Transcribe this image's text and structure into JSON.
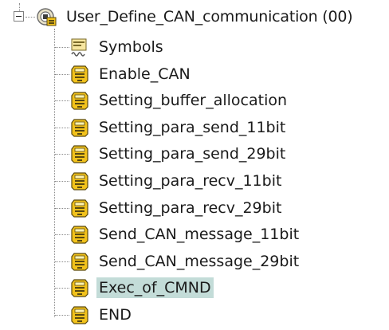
{
  "tree": {
    "root": {
      "label": "User_Define_CAN_communication (00)",
      "icon": "program-module-icon",
      "expanded": true
    },
    "children": [
      {
        "label": "Symbols",
        "icon": "symbols-icon",
        "selected": false
      },
      {
        "label": "Enable_CAN",
        "icon": "section-block-icon",
        "selected": false
      },
      {
        "label": "Setting_buffer_allocation",
        "icon": "section-block-icon",
        "selected": false
      },
      {
        "label": "Setting_para_send_11bit",
        "icon": "section-block-icon",
        "selected": false
      },
      {
        "label": "Setting_para_send_29bit",
        "icon": "section-block-icon",
        "selected": false
      },
      {
        "label": "Setting_para_recv_11bit",
        "icon": "section-block-icon",
        "selected": false
      },
      {
        "label": "Setting_para_recv_29bit",
        "icon": "section-block-icon",
        "selected": false
      },
      {
        "label": "Send_CAN_message_11bit",
        "icon": "section-block-icon",
        "selected": false
      },
      {
        "label": "Send_CAN_message_29bit",
        "icon": "section-block-icon",
        "selected": false
      },
      {
        "label": "Exec_of_CMND",
        "icon": "section-block-icon",
        "selected": true
      },
      {
        "label": "END",
        "icon": "section-block-icon",
        "selected": false
      }
    ],
    "colors": {
      "selection": "#c3dcd8",
      "icon_yellow": "#f2c21b",
      "icon_dark": "#5a4a10"
    }
  }
}
